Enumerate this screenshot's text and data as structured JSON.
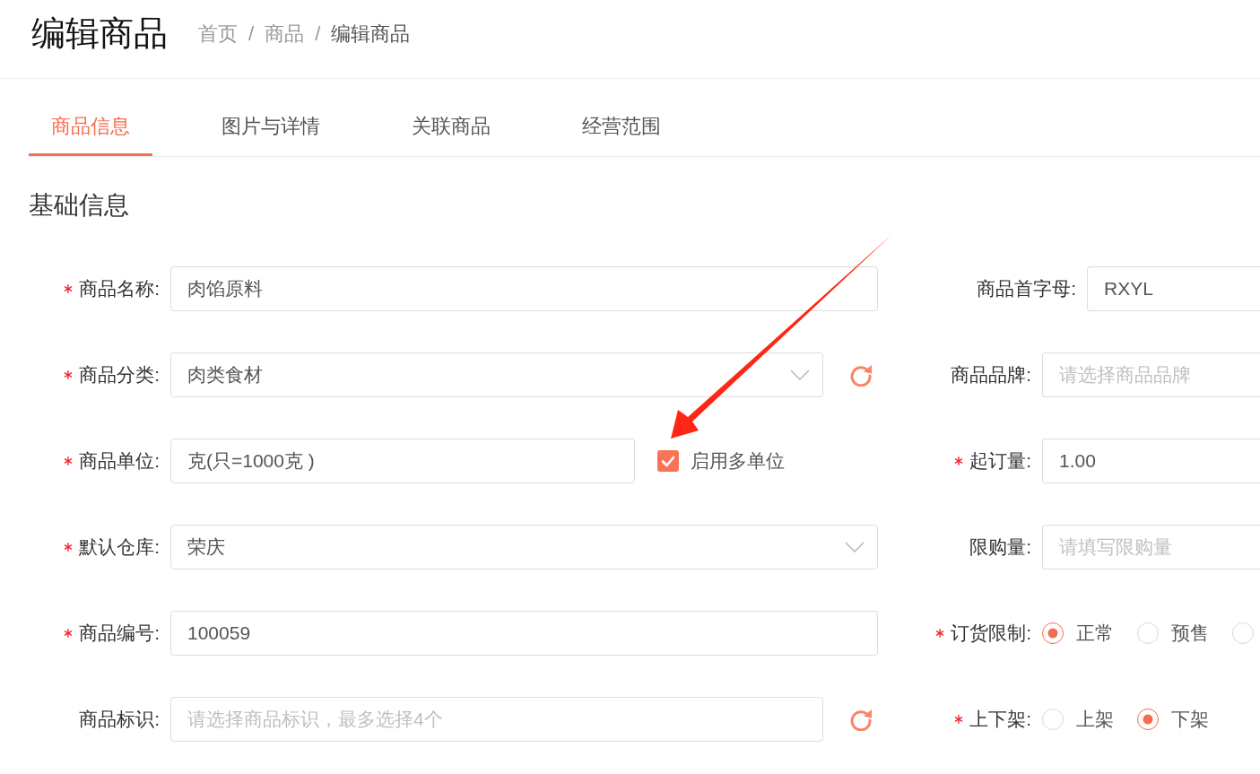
{
  "page_title": "编辑商品",
  "breadcrumb": [
    {
      "kind": "link",
      "label": "首页",
      "current": false
    },
    {
      "kind": "separator",
      "label": "/"
    },
    {
      "kind": "link",
      "label": "商品",
      "current": false
    },
    {
      "kind": "separator",
      "label": "/"
    },
    {
      "kind": "link",
      "label": "编辑商品",
      "current": true
    }
  ],
  "tabs": [
    {
      "label": "商品信息",
      "selected": true
    },
    {
      "label": "图片与详情",
      "selected": false
    },
    {
      "label": "关联商品",
      "selected": false
    },
    {
      "label": "经营范围",
      "selected": false
    }
  ],
  "section_title": "基础信息",
  "left_fields": [
    {
      "kind": "input",
      "label": "商品名称:",
      "required": true,
      "value": "肉馅原料"
    },
    {
      "kind": "select",
      "label": "商品分类:",
      "required": true,
      "value": "肉类食材",
      "refresh": true
    },
    {
      "kind": "input",
      "label": "商品单位:",
      "required": true,
      "value": "克(只=1000克 )",
      "checkbox": {
        "label": "启用多单位",
        "checked": true
      }
    },
    {
      "kind": "select",
      "label": "默认仓库:",
      "required": true,
      "value": "荣庆"
    },
    {
      "kind": "input",
      "label": "商品编号:",
      "required": true,
      "value": "100059"
    },
    {
      "kind": "input",
      "label": "商品标识:",
      "required": false,
      "placeholder": "请选择商品标识，最多选择4个",
      "refresh": true
    }
  ],
  "right_fields": [
    {
      "kind": "input",
      "label": "商品首字母:",
      "required": false,
      "value": "RXYL"
    },
    {
      "kind": "input",
      "label": "商品品牌:",
      "required": false,
      "placeholder": "请选择商品品牌"
    },
    {
      "kind": "input",
      "label": "起订量:",
      "required": true,
      "value": "1.00"
    },
    {
      "kind": "input",
      "label": "限购量:",
      "required": false,
      "placeholder": "请填写限购量"
    },
    {
      "kind": "radio",
      "label": "订货限制:",
      "required": true,
      "options": [
        {
          "label": "正常",
          "selected": true
        },
        {
          "label": "预售",
          "selected": false
        },
        {
          "selected": false
        }
      ]
    },
    {
      "kind": "radio",
      "label": "上下架:",
      "required": true,
      "options": [
        {
          "label": "上架",
          "selected": false
        },
        {
          "label": "下架",
          "selected": true
        }
      ]
    }
  ]
}
